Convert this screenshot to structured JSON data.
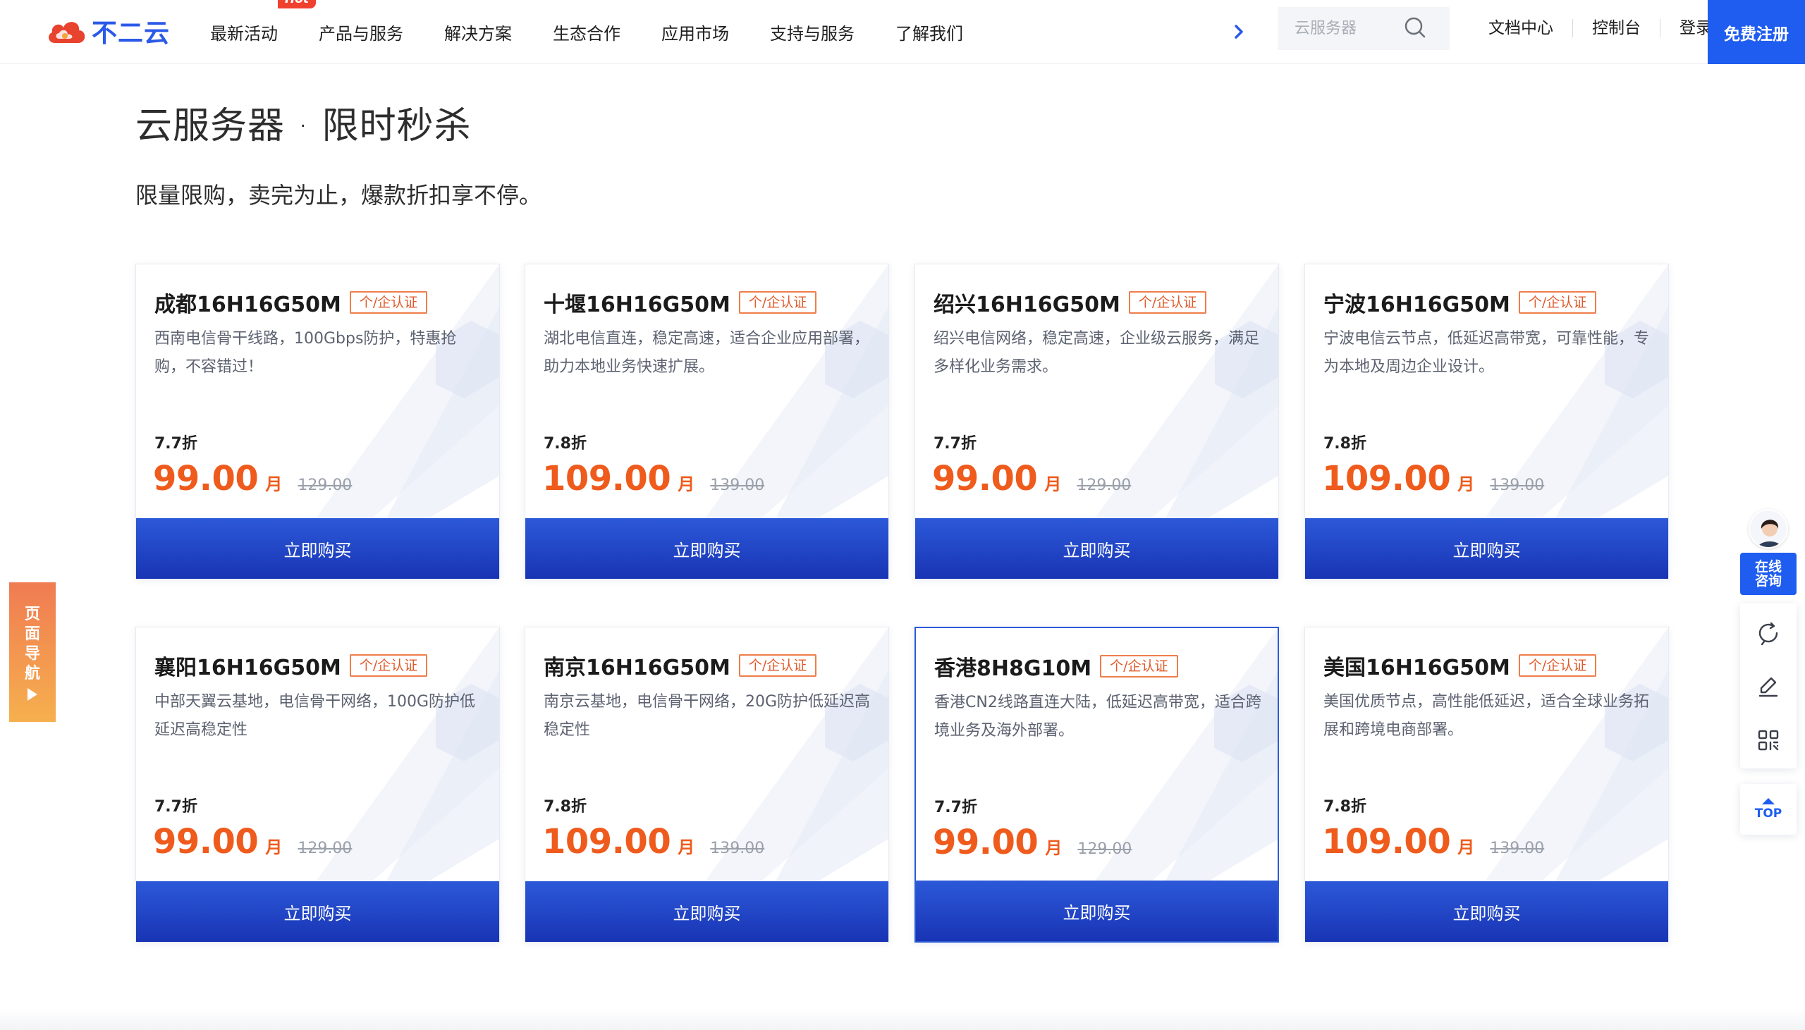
{
  "brand": {
    "name": "不二云"
  },
  "nav": {
    "items": [
      {
        "label": "最新活动",
        "badge": "Hot"
      },
      {
        "label": "产品与服务"
      },
      {
        "label": "解决方案"
      },
      {
        "label": "生态合作"
      },
      {
        "label": "应用市场"
      },
      {
        "label": "支持与服务"
      },
      {
        "label": "了解我们"
      }
    ],
    "search_placeholder": "云服务器",
    "links": [
      "文档中心",
      "控制台",
      "登录"
    ],
    "register": "免费注册"
  },
  "page": {
    "title": "云服务器 · 限时秒杀",
    "subtitle": "限量限购，卖完为止，爆款折扣享不停。"
  },
  "cards": [
    {
      "title": "成都16H16G50M",
      "tag": "个/企认证",
      "desc": "西南电信骨干线路，100Gbps防护，特惠抢购，不容错过！",
      "discount": "7.7折",
      "price": "99.00",
      "unit": "月",
      "old_price": "129.00",
      "button": "立即购买"
    },
    {
      "title": "十堰16H16G50M",
      "tag": "个/企认证",
      "desc": "湖北电信直连，稳定高速，适合企业应用部署，助力本地业务快速扩展。",
      "discount": "7.8折",
      "price": "109.00",
      "unit": "月",
      "old_price": "139.00",
      "button": "立即购买"
    },
    {
      "title": "绍兴16H16G50M",
      "tag": "个/企认证",
      "desc": "绍兴电信网络，稳定高速，企业级云服务，满足多样化业务需求。",
      "discount": "7.7折",
      "price": "99.00",
      "unit": "月",
      "old_price": "129.00",
      "button": "立即购买"
    },
    {
      "title": "宁波16H16G50M",
      "tag": "个/企认证",
      "desc": "宁波电信云节点，低延迟高带宽，可靠性能，专为本地及周边企业设计。",
      "discount": "7.8折",
      "price": "109.00",
      "unit": "月",
      "old_price": "139.00",
      "button": "立即购买"
    },
    {
      "title": "襄阳16H16G50M",
      "tag": "个/企认证",
      "desc": "中部天翼云基地，电信骨干网络，100G防护低延迟高稳定性",
      "discount": "7.7折",
      "price": "99.00",
      "unit": "月",
      "old_price": "129.00",
      "button": "立即购买"
    },
    {
      "title": "南京16H16G50M",
      "tag": "个/企认证",
      "desc": "南京云基地，电信骨干网络，20G防护低延迟高稳定性",
      "discount": "7.8折",
      "price": "109.00",
      "unit": "月",
      "old_price": "139.00",
      "button": "立即购买"
    },
    {
      "title": "香港8H8G10M",
      "tag": "个/企认证",
      "desc": "香港CN2线路直连大陆，低延迟高带宽，适合跨境业务及海外部署。",
      "discount": "7.7折",
      "price": "99.00",
      "unit": "月",
      "old_price": "129.00",
      "button": "立即购买"
    },
    {
      "title": "美国16H16G50M",
      "tag": "个/企认证",
      "desc": "美国优质节点，高性能低延迟，适合全球业务拓展和跨境电商部署。",
      "discount": "7.8折",
      "price": "109.00",
      "unit": "月",
      "old_price": "139.00",
      "button": "立即购买"
    }
  ],
  "side_left": {
    "chars": [
      "页",
      "面",
      "导",
      "航"
    ]
  },
  "side_right": {
    "consult": [
      "在线",
      "咨询"
    ],
    "tools": [
      "refresh-chat-icon",
      "edit-icon",
      "qrcode-icon"
    ],
    "top": "TOP"
  },
  "colors": {
    "primary": "#1f5df0",
    "price": "#ef5b1c",
    "button_top": "#2c59d9",
    "button_bottom": "#1834b4",
    "hot": "#f0412e"
  }
}
